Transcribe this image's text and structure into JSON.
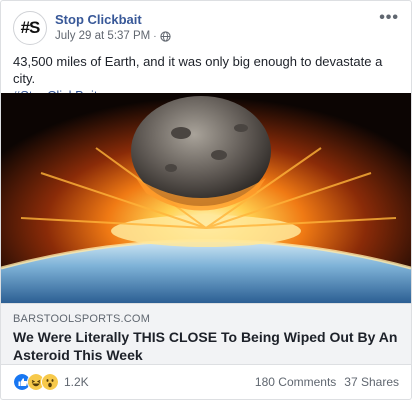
{
  "post": {
    "page_name": "Stop Clickbait",
    "avatar_text": "#S",
    "timestamp": "July 29 at 5:37 PM",
    "separator": "·",
    "more_menu": "•••",
    "text": "43,500 miles of Earth, and it was only big enough to devastate a city.",
    "hashtag": "#StopClickBait"
  },
  "link": {
    "domain": "BARSTOOLSPORTS.COM",
    "title": "We Were Literally THIS CLOSE To Being Wiped Out By An Asteroid This Week"
  },
  "footer": {
    "reaction_count": "1.2K",
    "comments": "180 Comments",
    "shares": "37 Shares"
  },
  "icons": {
    "reactions": [
      "like-icon",
      "haha-icon",
      "wow-icon"
    ],
    "privacy": "globe-icon"
  },
  "colors": {
    "link_blue": "#385898",
    "like_blue": "#1877f2",
    "emoji_yellow": "#f7c94b"
  }
}
